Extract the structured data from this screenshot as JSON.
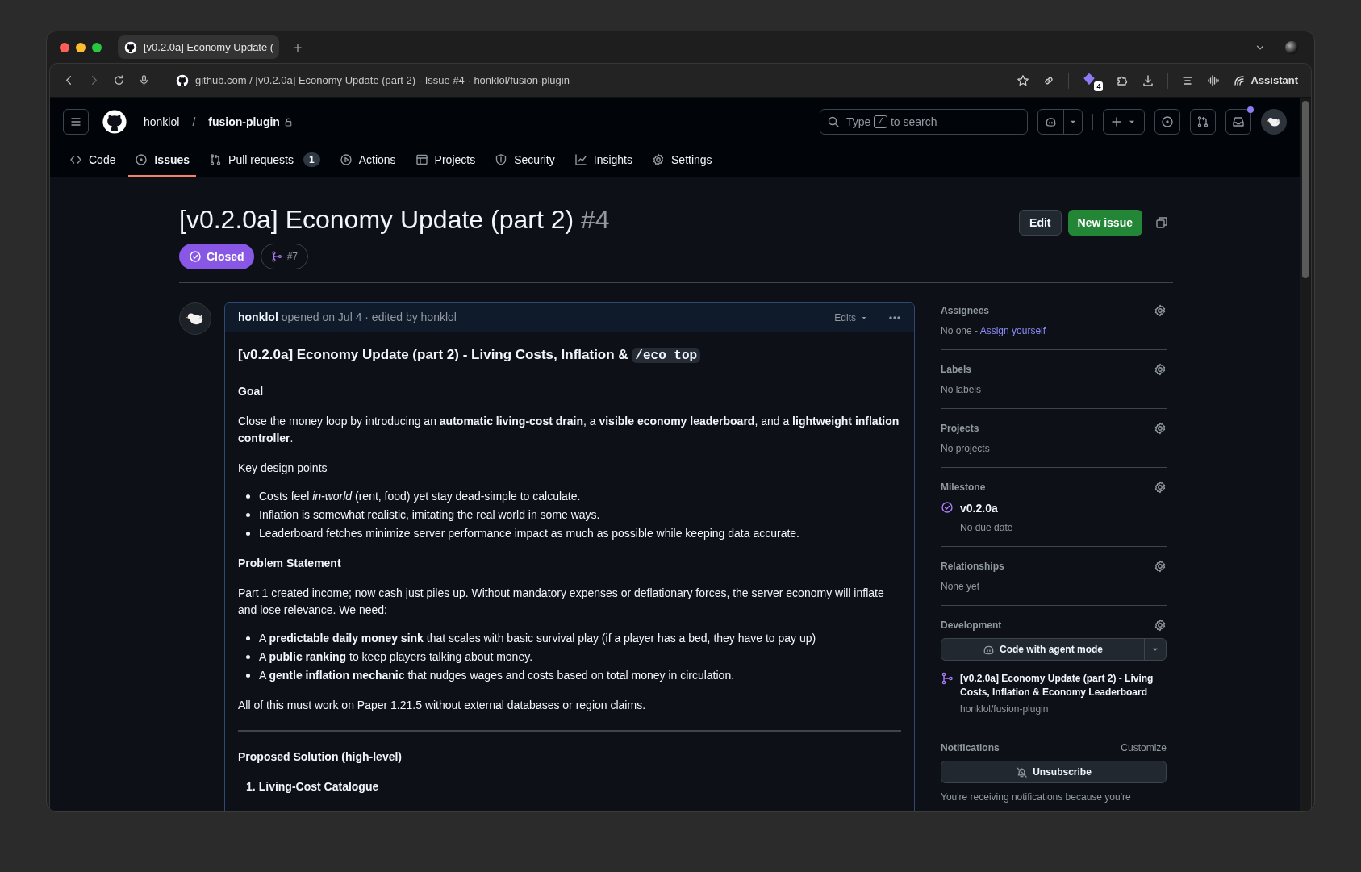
{
  "browser": {
    "tab_title": "[v0.2.0a] Economy Update (",
    "address": "github.com / [v0.2.0a] Economy Update (part 2) · Issue #4 · honklol/fusion-plugin",
    "extension_badge": "4",
    "assistant": "Assistant"
  },
  "header": {
    "owner": "honklol",
    "separator": "/",
    "repo": "fusion-plugin",
    "search": {
      "before": "Type",
      "key": "/",
      "after": "to search"
    },
    "notification_dot": true
  },
  "nav": [
    {
      "label": "Code",
      "selected": false
    },
    {
      "label": "Issues",
      "selected": true
    },
    {
      "label": "Pull requests",
      "selected": false,
      "counter": "1"
    },
    {
      "label": "Actions",
      "selected": false
    },
    {
      "label": "Projects",
      "selected": false
    },
    {
      "label": "Security",
      "selected": false
    },
    {
      "label": "Insights",
      "selected": false
    },
    {
      "label": "Settings",
      "selected": false
    }
  ],
  "issue": {
    "title": "[v0.2.0a] Economy Update (part 2)",
    "number": "#4",
    "closed": true,
    "state_label": "Closed",
    "linked": "#7",
    "buttons": [
      "Edit",
      "New issue"
    ]
  },
  "comment": {
    "author": "honklol",
    "meta": "opened on Jul 4 · edited by honklol",
    "edits": "Edits",
    "body": [
      {
        "kind": "title",
        "text": "[v0.2.0a] Economy Update (part 2) - Living Costs, Inflation &",
        "code": "/eco top"
      },
      {
        "kind": "heading",
        "text": "Goal"
      },
      {
        "kind": "p",
        "text": "Close the money loop by introducing an **automatic living-cost drain**, a **visible economy leaderboard**, and a **lightweight inflation controller**."
      },
      {
        "kind": "p",
        "text": "Key design points"
      },
      {
        "kind": "ul",
        "items": [
          "Costs feel *in-world* (rent, food) yet stay dead-simple to calculate.",
          "Inflation is somewhat realistic, imitating the real world in some ways.",
          "Leaderboard fetches minimize server performance impact as much as possible while keeping data accurate."
        ]
      },
      {
        "kind": "heading",
        "text": "Problem Statement"
      },
      {
        "kind": "p",
        "text": "Part 1 created income; now cash just piles up. Without mandatory expenses or deflationary forces, the server economy will inflate and lose relevance. We need:"
      },
      {
        "kind": "ul",
        "items": [
          "A **predictable daily money sink** that scales with basic survival play (if a player has a bed, they have to pay up)",
          "A **public ranking** to keep players talking about money.",
          "A **gentle inflation mechanic** that nudges wages and costs based on total money in circulation."
        ]
      },
      {
        "kind": "p",
        "text": "All of this must work on Paper 1.21.5 without external databases or region claims."
      },
      {
        "kind": "hr"
      },
      {
        "kind": "heading",
        "text": "Proposed Solution (high-level)"
      },
      {
        "kind": "ol",
        "items": [
          {
            "marker": "1.",
            "text": "Living-Cost Catalogue"
          }
        ]
      }
    ]
  },
  "sidebar": [
    {
      "heading": "Assignees",
      "kind": "assignees",
      "value": "No one -",
      "link": "Assign yourself"
    },
    {
      "heading": "Labels",
      "kind": "text",
      "value": "No labels"
    },
    {
      "heading": "Projects",
      "kind": "text",
      "value": "No projects"
    },
    {
      "heading": "Milestone",
      "kind": "milestone",
      "name": "v0.2.0a",
      "detail": "No due date"
    },
    {
      "heading": "Relationships",
      "kind": "text",
      "value": "None yet"
    },
    {
      "heading": "Development",
      "kind": "development",
      "button": "Code with agent mode",
      "branch_title": "[v0.2.0a] Economy Update (part 2) - Living Costs, Inflation & Economy Leaderboard",
      "branch_repo": "honklol/fusion-plugin"
    },
    {
      "heading": "Notifications",
      "kind": "notifications",
      "action": "Customize",
      "button": "Unsubscribe",
      "note": "You're receiving notifications because you're"
    }
  ]
}
